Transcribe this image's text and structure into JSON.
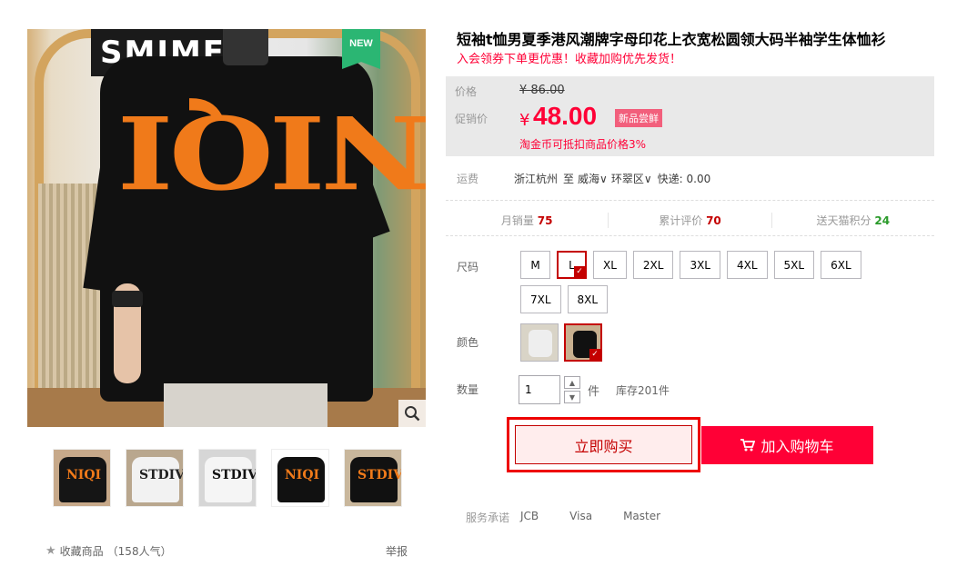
{
  "product": {
    "title": "短袖t恤男夏季港风潮牌字母印花上衣宽松圆领大码半袖学生体恤衫",
    "subtitle": "入会领券下单更优惠！收藏加购优先发货！",
    "badge": "NEW",
    "main_image_print": "NIQI",
    "poster_text": "SMIME"
  },
  "thumbnails": [
    {
      "print": "NIQI",
      "bg": "#c7a98a",
      "shirt": "#151515",
      "ink": "#f07a1a"
    },
    {
      "print": "STDIVO",
      "bg": "#b9a78e",
      "shirt": "#f2f2f2",
      "ink": "#222"
    },
    {
      "print": "STDIVO",
      "bg": "#d6d6d6",
      "shirt": "#f5f5f5",
      "ink": "#111"
    },
    {
      "print": "NIQI",
      "bg": "#ffffff",
      "shirt": "#111",
      "ink": "#f07a1a"
    },
    {
      "print": "STDIVO",
      "bg": "#c9b79c",
      "shirt": "#111",
      "ink": "#f07a1a"
    }
  ],
  "favorite": {
    "label": "收藏商品",
    "count": "（158人气）"
  },
  "report": "举报",
  "price": {
    "label": "价格",
    "original": "¥ 86.00",
    "promo_label": "促销价",
    "currency": "¥",
    "sale": "48.00",
    "tag": "新品尝鲜",
    "coin_note": "淘金币可抵扣商品价格3%"
  },
  "shipping": {
    "label": "运费",
    "from": "浙江杭州",
    "to_word": "至",
    "city": "威海",
    "district": "环翠区",
    "express": "快递: 0.00"
  },
  "stats": {
    "monthly_sales_label": "月销量",
    "monthly_sales": "75",
    "reviews_label": "累计评价",
    "reviews": "70",
    "points_label": "送天猫积分",
    "points": "24"
  },
  "size": {
    "label": "尺码",
    "options": [
      "M",
      "L",
      "XL",
      "2XL",
      "3XL",
      "4XL",
      "5XL",
      "6XL",
      "7XL",
      "8XL"
    ],
    "selected": "L"
  },
  "color": {
    "label": "颜色",
    "options": [
      {
        "name": "white",
        "shirt": "#eeeeee"
      },
      {
        "name": "black",
        "shirt": "#111111"
      }
    ],
    "selected": "black"
  },
  "quantity": {
    "label": "数量",
    "value": "1",
    "unit": "件",
    "stock": "库存201件"
  },
  "actions": {
    "buy_now": "立即购买",
    "add_to_cart": "加入购物车"
  },
  "service": {
    "label": "服务承诺",
    "items": [
      "JCB",
      "Visa",
      "Master"
    ]
  },
  "colors": {
    "accent": "#ff0036",
    "dark_red": "#c40000",
    "badge_green": "#2bb673"
  }
}
